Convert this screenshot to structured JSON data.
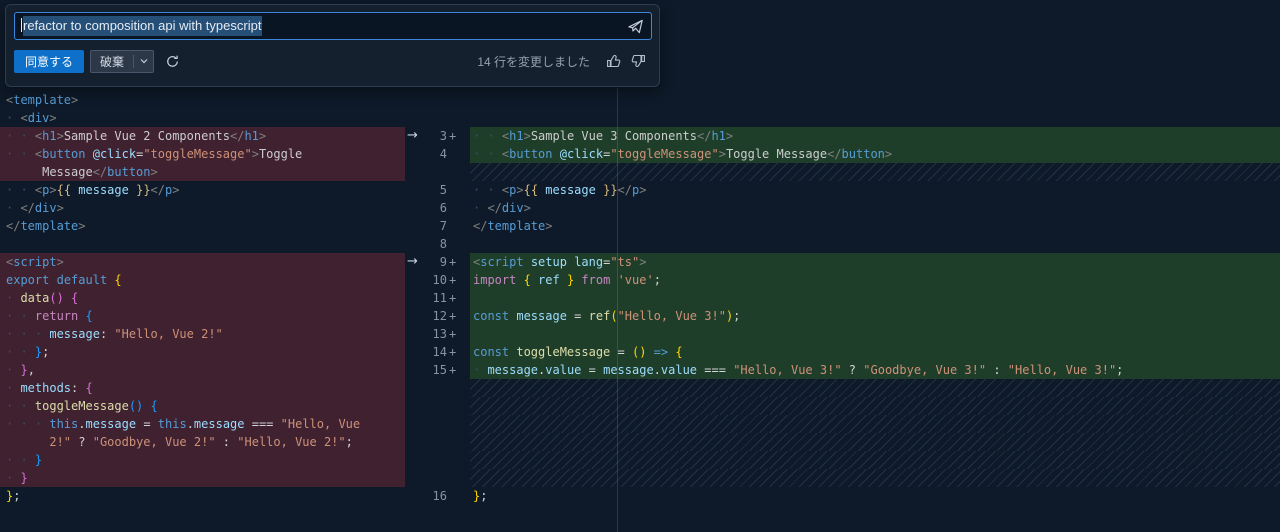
{
  "widget": {
    "input": {
      "value": "refactor to composition api with typescript"
    },
    "accept_label": "同意する",
    "discard_label": "破棄",
    "status_text": "14 行を変更しました"
  },
  "icons": {
    "send_button": "paper-plane-send",
    "discard_dropdown": "chevron-down",
    "rerun_button": "refresh",
    "feedback_positive": "thumbs-up",
    "feedback_negative": "thumbs-down",
    "diff_change_marker": "arrow-right"
  },
  "colors": {
    "editor_bg": "#0e1a29",
    "widget_bg": "#15202f",
    "focus_border": "#3c86dc",
    "accept_button_bg": "#0e70c8",
    "selection_bg": "#264f78",
    "removed_line_bg": "#3f2130",
    "added_line_bg": "#1f3e2a",
    "line_number_fg": "#8793a0",
    "tokens": {
      "ab": "#808080",
      "tag": "#569cd6",
      "attr": "#9cdcfe",
      "str": "#ce9178",
      "txt": "#cccccc",
      "kw": "#569cd6",
      "ctl": "#c586c0",
      "fn": "#dcdcaa",
      "var": "#9cdcfe",
      "op": "#d4d4d4",
      "pu": "#d4d4d4",
      "b1": "#ffd700",
      "b2": "#da70d6",
      "b3": "#179fff",
      "ib": "#d7ba7d",
      "ws": "#3a4f63"
    }
  },
  "diff": {
    "arrow_glyph": "→",
    "arrow_rows": [
      2,
      9
    ],
    "left_rows": [
      {
        "bg": "none",
        "tokens": [
          [
            "ab",
            "<"
          ],
          [
            "tag",
            "template"
          ],
          [
            "ab",
            ">"
          ]
        ]
      },
      {
        "bg": "none",
        "tokens": [
          [
            "ws",
            "· "
          ],
          [
            "ab",
            "<"
          ],
          [
            "tag",
            "div"
          ],
          [
            "ab",
            ">"
          ]
        ]
      },
      {
        "bg": "removed",
        "tokens": [
          [
            "ws",
            "· · "
          ],
          [
            "ab",
            "<"
          ],
          [
            "tag",
            "h1"
          ],
          [
            "ab",
            ">"
          ],
          [
            "txt",
            "Sample Vue 2 Components"
          ],
          [
            "ab",
            "</"
          ],
          [
            "tag",
            "h1"
          ],
          [
            "ab",
            ">"
          ]
        ]
      },
      {
        "bg": "removed",
        "tokens": [
          [
            "ws",
            "· · "
          ],
          [
            "ab",
            "<"
          ],
          [
            "tag",
            "button"
          ],
          [
            "txt",
            " "
          ],
          [
            "attr",
            "@click"
          ],
          [
            "op",
            "="
          ],
          [
            "str",
            "\"toggleMessage\""
          ],
          [
            "ab",
            ">"
          ],
          [
            "txt",
            "Toggle"
          ]
        ]
      },
      {
        "bg": "removed",
        "indent": 5,
        "tokens": [
          [
            "txt",
            "Message"
          ],
          [
            "ab",
            "</"
          ],
          [
            "tag",
            "button"
          ],
          [
            "ab",
            ">"
          ]
        ]
      },
      {
        "bg": "none",
        "tokens": [
          [
            "ws",
            "· · "
          ],
          [
            "ab",
            "<"
          ],
          [
            "tag",
            "p"
          ],
          [
            "ab",
            ">"
          ],
          [
            "ib",
            "{{"
          ],
          [
            "var",
            " message "
          ],
          [
            "ib",
            "}}"
          ],
          [
            "ab",
            "</"
          ],
          [
            "tag",
            "p"
          ],
          [
            "ab",
            ">"
          ]
        ]
      },
      {
        "bg": "none",
        "tokens": [
          [
            "ws",
            "· "
          ],
          [
            "ab",
            "</"
          ],
          [
            "tag",
            "div"
          ],
          [
            "ab",
            ">"
          ]
        ]
      },
      {
        "bg": "none",
        "tokens": [
          [
            "ab",
            "</"
          ],
          [
            "tag",
            "template"
          ],
          [
            "ab",
            ">"
          ]
        ]
      },
      {
        "bg": "none",
        "tokens": []
      },
      {
        "bg": "removed",
        "tokens": [
          [
            "ab",
            "<"
          ],
          [
            "tag",
            "script"
          ],
          [
            "ab",
            ">"
          ]
        ]
      },
      {
        "bg": "removed",
        "tokens": [
          [
            "kw",
            "export"
          ],
          [
            "txt",
            " "
          ],
          [
            "kw",
            "default"
          ],
          [
            "txt",
            " "
          ],
          [
            "b1",
            "{"
          ]
        ]
      },
      {
        "bg": "removed",
        "tokens": [
          [
            "ws",
            "· "
          ],
          [
            "fn",
            "data"
          ],
          [
            "b2",
            "()"
          ],
          [
            "txt",
            " "
          ],
          [
            "b2",
            "{"
          ]
        ]
      },
      {
        "bg": "removed",
        "tokens": [
          [
            "ws",
            "· · "
          ],
          [
            "ctl",
            "return"
          ],
          [
            "txt",
            " "
          ],
          [
            "b3",
            "{"
          ]
        ]
      },
      {
        "bg": "removed",
        "tokens": [
          [
            "ws",
            "· · · "
          ],
          [
            "var",
            "message"
          ],
          [
            "pu",
            ":"
          ],
          [
            "txt",
            " "
          ],
          [
            "str",
            "\"Hello, Vue 2!\""
          ]
        ]
      },
      {
        "bg": "removed",
        "tokens": [
          [
            "ws",
            "· · "
          ],
          [
            "b3",
            "}"
          ],
          [
            "pu",
            ";"
          ]
        ]
      },
      {
        "bg": "removed",
        "tokens": [
          [
            "ws",
            "· "
          ],
          [
            "b2",
            "}"
          ],
          [
            "pu",
            ","
          ]
        ]
      },
      {
        "bg": "removed",
        "tokens": [
          [
            "ws",
            "· "
          ],
          [
            "var",
            "methods"
          ],
          [
            "pu",
            ":"
          ],
          [
            "txt",
            " "
          ],
          [
            "b2",
            "{"
          ]
        ]
      },
      {
        "bg": "removed",
        "tokens": [
          [
            "ws",
            "· · "
          ],
          [
            "fn",
            "toggleMessage"
          ],
          [
            "b3",
            "()"
          ],
          [
            "txt",
            " "
          ],
          [
            "b3",
            "{"
          ]
        ]
      },
      {
        "bg": "removed",
        "tokens": [
          [
            "ws",
            "· · · "
          ],
          [
            "kw",
            "this"
          ],
          [
            "pu",
            "."
          ],
          [
            "var",
            "message"
          ],
          [
            "txt",
            " "
          ],
          [
            "op",
            "="
          ],
          [
            "txt",
            " "
          ],
          [
            "kw",
            "this"
          ],
          [
            "pu",
            "."
          ],
          [
            "var",
            "message"
          ],
          [
            "txt",
            " "
          ],
          [
            "op",
            "==="
          ],
          [
            "txt",
            " "
          ],
          [
            "str",
            "\"Hello, Vue"
          ]
        ]
      },
      {
        "bg": "removed",
        "indent": 6,
        "tokens": [
          [
            "str",
            "2!\""
          ],
          [
            "txt",
            " "
          ],
          [
            "op",
            "?"
          ],
          [
            "txt",
            " "
          ],
          [
            "str",
            "\"Goodbye, Vue 2!\""
          ],
          [
            "txt",
            " "
          ],
          [
            "op",
            ":"
          ],
          [
            "txt",
            " "
          ],
          [
            "str",
            "\"Hello, Vue 2!\""
          ],
          [
            "pu",
            ";"
          ]
        ]
      },
      {
        "bg": "removed",
        "tokens": [
          [
            "ws",
            "· · "
          ],
          [
            "b3",
            "}"
          ]
        ]
      },
      {
        "bg": "removed",
        "tokens": [
          [
            "ws",
            "· "
          ],
          [
            "b2",
            "}"
          ]
        ]
      },
      {
        "bg": "none",
        "tokens": [
          [
            "b1",
            "}"
          ],
          [
            "pu",
            ";"
          ]
        ]
      }
    ],
    "right_rows": [
      {
        "num": "",
        "bg": "none",
        "tokens": []
      },
      {
        "num": "",
        "bg": "none",
        "tokens": []
      },
      {
        "num": "3",
        "plus": true,
        "bg": "added",
        "tokens": [
          [
            "ws",
            "· · "
          ],
          [
            "ab",
            "<"
          ],
          [
            "tag",
            "h1"
          ],
          [
            "ab",
            ">"
          ],
          [
            "txt",
            "Sample Vue 3 Components"
          ],
          [
            "ab",
            "</"
          ],
          [
            "tag",
            "h1"
          ],
          [
            "ab",
            ">"
          ]
        ]
      },
      {
        "num": "4",
        "bg": "added",
        "tokens": [
          [
            "ws",
            "· · "
          ],
          [
            "ab",
            "<"
          ],
          [
            "tag",
            "button"
          ],
          [
            "txt",
            " "
          ],
          [
            "attr",
            "@click"
          ],
          [
            "op",
            "="
          ],
          [
            "str",
            "\"toggleMessage\""
          ],
          [
            "ab",
            ">"
          ],
          [
            "txt",
            "Toggle Message"
          ],
          [
            "ab",
            "</"
          ],
          [
            "tag",
            "button"
          ],
          [
            "ab",
            ">"
          ]
        ]
      },
      {
        "num": "",
        "bg": "hatch",
        "tokens": []
      },
      {
        "num": "5",
        "bg": "none",
        "tokens": [
          [
            "ws",
            "· · "
          ],
          [
            "ab",
            "<"
          ],
          [
            "tag",
            "p"
          ],
          [
            "ab",
            ">"
          ],
          [
            "ib",
            "{{"
          ],
          [
            "var",
            " message "
          ],
          [
            "ib",
            "}}"
          ],
          [
            "ab",
            "</"
          ],
          [
            "tag",
            "p"
          ],
          [
            "ab",
            ">"
          ]
        ]
      },
      {
        "num": "6",
        "bg": "none",
        "tokens": [
          [
            "ws",
            "· "
          ],
          [
            "ab",
            "</"
          ],
          [
            "tag",
            "div"
          ],
          [
            "ab",
            ">"
          ]
        ]
      },
      {
        "num": "7",
        "bg": "none",
        "tokens": [
          [
            "ab",
            "</"
          ],
          [
            "tag",
            "template"
          ],
          [
            "ab",
            ">"
          ]
        ]
      },
      {
        "num": "8",
        "bg": "none",
        "tokens": []
      },
      {
        "num": "9",
        "plus": true,
        "bg": "added",
        "tokens": [
          [
            "ab",
            "<"
          ],
          [
            "tag",
            "script"
          ],
          [
            "txt",
            " "
          ],
          [
            "attr",
            "setup"
          ],
          [
            "txt",
            " "
          ],
          [
            "attr",
            "lang"
          ],
          [
            "op",
            "="
          ],
          [
            "str",
            "\"ts\""
          ],
          [
            "ab",
            ">"
          ]
        ]
      },
      {
        "num": "10",
        "plus": true,
        "bg": "added",
        "tokens": [
          [
            "ctl",
            "import"
          ],
          [
            "txt",
            " "
          ],
          [
            "b1",
            "{"
          ],
          [
            "var",
            " ref "
          ],
          [
            "b1",
            "}"
          ],
          [
            "txt",
            " "
          ],
          [
            "ctl",
            "from"
          ],
          [
            "txt",
            " "
          ],
          [
            "str",
            "'vue'"
          ],
          [
            "pu",
            ";"
          ]
        ]
      },
      {
        "num": "11",
        "plus": true,
        "bg": "added",
        "tokens": []
      },
      {
        "num": "12",
        "plus": true,
        "bg": "added",
        "tokens": [
          [
            "kw",
            "const"
          ],
          [
            "txt",
            " "
          ],
          [
            "var",
            "message"
          ],
          [
            "txt",
            " "
          ],
          [
            "op",
            "="
          ],
          [
            "txt",
            " "
          ],
          [
            "fn",
            "ref"
          ],
          [
            "b1",
            "("
          ],
          [
            "str",
            "\"Hello, Vue 3!\""
          ],
          [
            "b1",
            ")"
          ],
          [
            "pu",
            ";"
          ]
        ]
      },
      {
        "num": "13",
        "plus": true,
        "bg": "added",
        "tokens": []
      },
      {
        "num": "14",
        "plus": true,
        "bg": "added",
        "tokens": [
          [
            "kw",
            "const"
          ],
          [
            "txt",
            " "
          ],
          [
            "fn",
            "toggleMessage"
          ],
          [
            "txt",
            " "
          ],
          [
            "op",
            "="
          ],
          [
            "txt",
            " "
          ],
          [
            "b1",
            "()"
          ],
          [
            "txt",
            " "
          ],
          [
            "kw",
            "=>"
          ],
          [
            "txt",
            " "
          ],
          [
            "b1",
            "{"
          ]
        ]
      },
      {
        "num": "15",
        "plus": true,
        "bg": "added",
        "tokens": [
          [
            "ws",
            "· "
          ],
          [
            "var",
            "message"
          ],
          [
            "pu",
            "."
          ],
          [
            "var",
            "value"
          ],
          [
            "txt",
            " "
          ],
          [
            "op",
            "="
          ],
          [
            "txt",
            " "
          ],
          [
            "var",
            "message"
          ],
          [
            "pu",
            "."
          ],
          [
            "var",
            "value"
          ],
          [
            "txt",
            " "
          ],
          [
            "op",
            "==="
          ],
          [
            "txt",
            " "
          ],
          [
            "str",
            "\"Hello, Vue 3!\""
          ],
          [
            "txt",
            " "
          ],
          [
            "op",
            "?"
          ],
          [
            "txt",
            " "
          ],
          [
            "str",
            "\"Goodbye, Vue 3!\""
          ],
          [
            "txt",
            " "
          ],
          [
            "op",
            ":"
          ],
          [
            "txt",
            " "
          ],
          [
            "str",
            "\"Hello, Vue 3!\""
          ],
          [
            "pu",
            ";"
          ]
        ]
      },
      {
        "num": "",
        "bg": "hatch",
        "tokens": []
      },
      {
        "num": "",
        "bg": "hatch",
        "tokens": []
      },
      {
        "num": "",
        "bg": "hatch",
        "tokens": []
      },
      {
        "num": "",
        "bg": "hatch",
        "tokens": []
      },
      {
        "num": "",
        "bg": "hatch",
        "tokens": []
      },
      {
        "num": "",
        "bg": "hatch",
        "tokens": []
      },
      {
        "num": "16",
        "bg": "none",
        "tokens": [
          [
            "b1",
            "}"
          ],
          [
            "pu",
            ";"
          ]
        ]
      }
    ]
  }
}
